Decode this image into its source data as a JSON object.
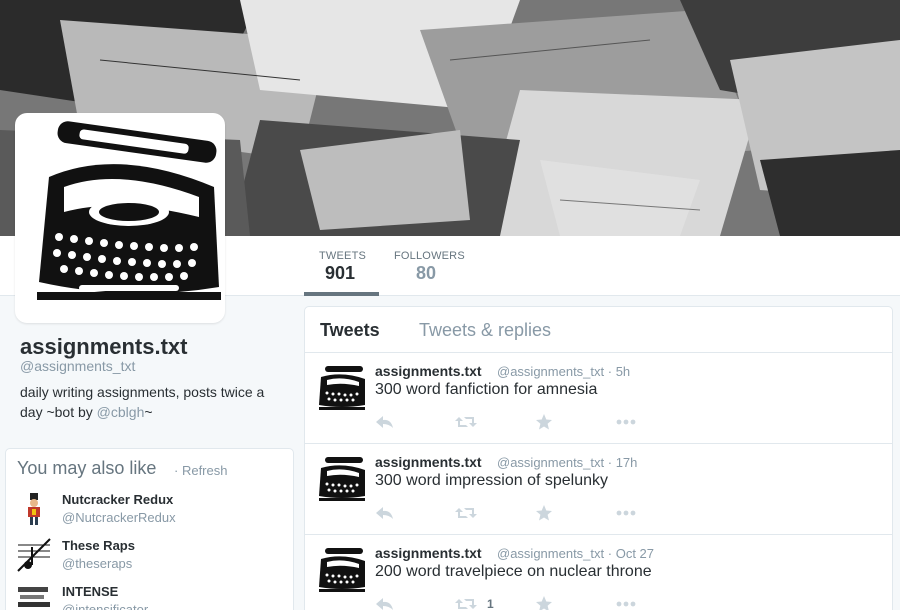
{
  "profile": {
    "name": "assignments.txt",
    "handle": "@assignments_txt",
    "bio_text": "daily writing assignments, posts twice a day ~bot by ",
    "bio_mention": "@cblgh",
    "bio_end": "~"
  },
  "nav": {
    "tweets_label": "TWEETS",
    "tweets_count": "901",
    "followers_label": "FOLLOWERS",
    "followers_count": "80"
  },
  "timeline": {
    "tab_tweets": "Tweets",
    "tab_replies": "Tweets & replies",
    "tweets": [
      {
        "name": "assignments.txt",
        "handle": "@assignments_txt",
        "time": "5h",
        "text": "300 word fanfiction for amnesia",
        "retweets": ""
      },
      {
        "name": "assignments.txt",
        "handle": "@assignments_txt",
        "time": "17h",
        "text": "300 word impression of spelunky",
        "retweets": ""
      },
      {
        "name": "assignments.txt",
        "handle": "@assignments_txt",
        "time": "Oct 27",
        "text": "200 word travelpiece on nuclear throne",
        "retweets": "1"
      }
    ]
  },
  "wtf": {
    "title": "You may also like",
    "refresh": "Refresh",
    "accounts": [
      {
        "name": "Nutcracker Redux",
        "handle": "@NutcrackerRedux"
      },
      {
        "name": "These Raps",
        "handle": "@theseraps"
      },
      {
        "name": "INTENSE",
        "handle": "@intensificator"
      }
    ]
  },
  "colors": {
    "muted": "#8899a6",
    "text": "#292f33",
    "border": "#e1e8ed",
    "icon": "#ccd6dd"
  }
}
